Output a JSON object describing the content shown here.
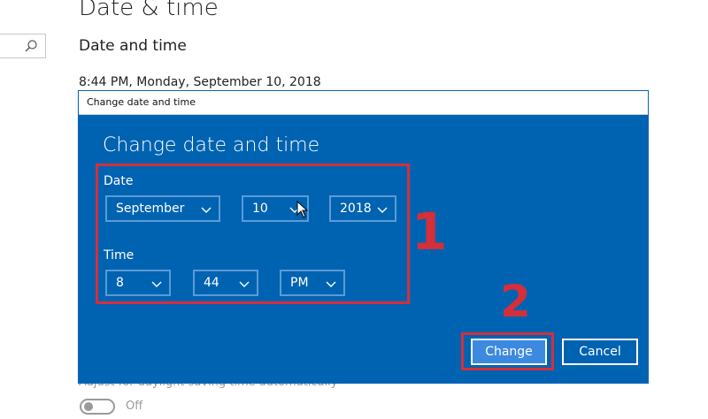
{
  "settings": {
    "page_title": "Date & time",
    "section_title": "Date and time",
    "current_datetime": "8:44 PM, Monday, September 10, 2018",
    "dst_label": "Adjust for daylight saving time automatically",
    "dst_toggle_state": "Off"
  },
  "search": {
    "icon": "search-icon"
  },
  "dialog": {
    "window_title": "Change date and time",
    "heading": "Change date and time",
    "date_label": "Date",
    "time_label": "Time",
    "month": "September",
    "day": "10",
    "year": "2018",
    "hour": "8",
    "minute": "44",
    "ampm": "PM",
    "change_label": "Change",
    "cancel_label": "Cancel"
  },
  "annotations": {
    "step1": "1",
    "step2": "2",
    "color": "#d42f3a"
  },
  "colors": {
    "dialog_bg": "#0063b1",
    "primary_button": "#3c8ae0"
  }
}
